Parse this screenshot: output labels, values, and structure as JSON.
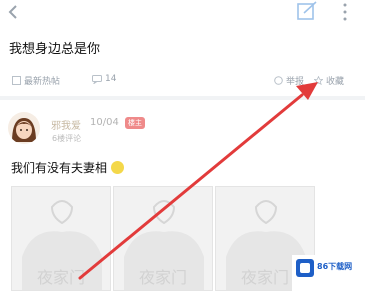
{
  "header": {
    "back_icon": "back-chevron-icon",
    "share_icon": "share-edit-icon",
    "more_icon": "more-vertical-icon"
  },
  "post": {
    "title": "我想身边总是你",
    "meta_left": "最新热帖",
    "comment_count": "14",
    "meta_right_1": "举报",
    "meta_right_2": "收藏"
  },
  "reply": {
    "username": "邪我爱",
    "time": "10/04",
    "badge": "楼主",
    "subtitle": "6楼评论",
    "text": "我们有没有夫妻相"
  },
  "thumbnails": [
    {
      "caption": "夜家门"
    },
    {
      "caption": "夜家门"
    },
    {
      "caption": "夜家门"
    }
  ],
  "annotation": {
    "arrow_color": "#e23b3b"
  },
  "watermark": {
    "text": "86下载网"
  }
}
